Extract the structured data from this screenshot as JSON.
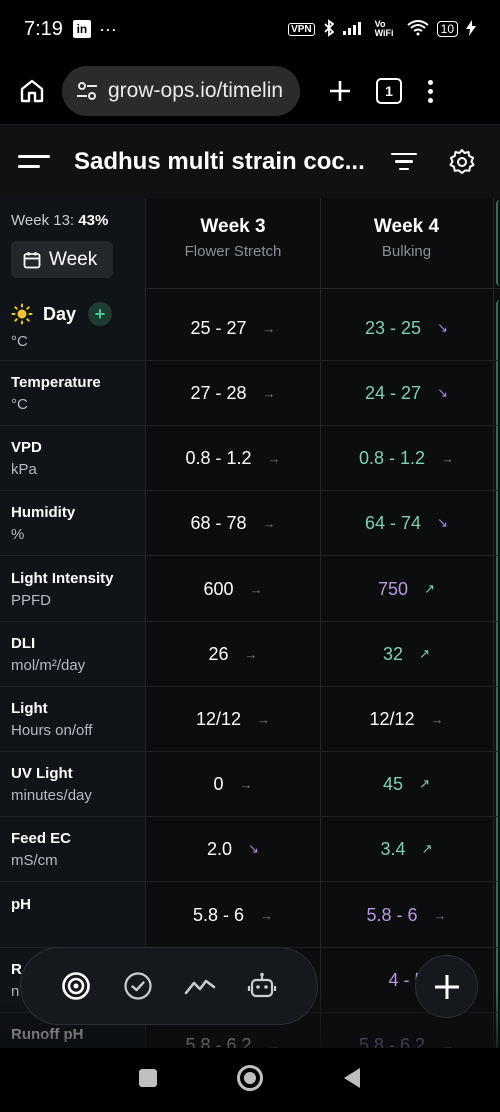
{
  "status_bar": {
    "time": "7:19",
    "left_icons": [
      "linkedin-icon",
      "more-dots-icon"
    ],
    "vpn": "VPN",
    "battery": "10",
    "network": "Vo WiFi"
  },
  "browser": {
    "url": "grow-ops.io/timelin",
    "tab_count": "1"
  },
  "app": {
    "title": "Sadhus multi strain coc..."
  },
  "timeline": {
    "week_progress_label": "Week 13:",
    "week_progress_value": "43%",
    "week_button": "Week",
    "day_toggle": "Day",
    "day_add": "+",
    "weeks": [
      {
        "name": "Week 3",
        "phase": "Flower Stretch"
      },
      {
        "name": "Week 4",
        "phase": "Bulking"
      }
    ],
    "partial_top_row": {
      "unit": "°C",
      "values": [
        {
          "text": "25 - 27",
          "arrow": "→",
          "color": "#ffffff",
          "arrow_color": "#747a82"
        },
        {
          "text": "23 - 25",
          "arrow": "↘",
          "color": "#7fd0b2",
          "arrow_color": "#a58ae0"
        }
      ]
    },
    "rows": [
      {
        "label": "Temperature",
        "unit": "°C",
        "values": [
          {
            "text": "27 - 28",
            "arrow": "→",
            "color": "#ffffff",
            "arrow_color": "#747a82"
          },
          {
            "text": "24 - 27",
            "arrow": "↘",
            "color": "#7fd0b2",
            "arrow_color": "#a58ae0"
          }
        ]
      },
      {
        "label": "VPD",
        "unit": "kPa",
        "values": [
          {
            "text": "0.8 - 1.2",
            "arrow": "→",
            "color": "#ffffff",
            "arrow_color": "#747a82"
          },
          {
            "text": "0.8 - 1.2",
            "arrow": "→",
            "color": "#7fd0b2",
            "arrow_color": "#747a82"
          }
        ]
      },
      {
        "label": "Humidity",
        "unit": "%",
        "values": [
          {
            "text": "68 - 78",
            "arrow": "→",
            "color": "#ffffff",
            "arrow_color": "#747a82"
          },
          {
            "text": "64 - 74",
            "arrow": "↘",
            "color": "#7fd0b2",
            "arrow_color": "#a58ae0"
          }
        ]
      },
      {
        "label": "Light Intensity",
        "unit": "PPFD",
        "values": [
          {
            "text": "600",
            "arrow": "→",
            "color": "#ffffff",
            "arrow_color": "#747a82"
          },
          {
            "text": "750",
            "arrow": "↗",
            "color": "#b79ae0",
            "arrow_color": "#7fd0b2"
          }
        ]
      },
      {
        "label": "DLI",
        "unit": "mol/m²/day",
        "values": [
          {
            "text": "26",
            "arrow": "→",
            "color": "#ffffff",
            "arrow_color": "#747a82"
          },
          {
            "text": "32",
            "arrow": "↗",
            "color": "#7fd0b2",
            "arrow_color": "#7fd0b2"
          }
        ]
      },
      {
        "label": "Light",
        "unit": "Hours on/off",
        "values": [
          {
            "text": "12/12",
            "arrow": "→",
            "color": "#ffffff",
            "arrow_color": "#747a82"
          },
          {
            "text": "12/12",
            "arrow": "→",
            "color": "#ffffff",
            "arrow_color": "#747a82"
          }
        ]
      },
      {
        "label": "UV Light",
        "unit": "minutes/day",
        "values": [
          {
            "text": "0",
            "arrow": "→",
            "color": "#ffffff",
            "arrow_color": "#747a82"
          },
          {
            "text": "45",
            "arrow": "↗",
            "color": "#7fd0b2",
            "arrow_color": "#7fd0b2"
          }
        ]
      },
      {
        "label": "Feed EC",
        "unit": "mS/cm",
        "values": [
          {
            "text": "2.0",
            "arrow": "↘",
            "color": "#ffffff",
            "arrow_color": "#a58ae0"
          },
          {
            "text": "3.4",
            "arrow": "↗",
            "color": "#7fd0b2",
            "arrow_color": "#7fd0b2"
          }
        ]
      },
      {
        "label": "pH",
        "unit": "",
        "values": [
          {
            "text": "5.8 - 6",
            "arrow": "→",
            "color": "#ffffff",
            "arrow_color": "#747a82"
          },
          {
            "text": "5.8 - 6",
            "arrow": "→",
            "color": "#b79ae0",
            "arrow_color": "#747a82"
          }
        ]
      },
      {
        "label": "R",
        "unit": "n",
        "values": [
          {
            "text": "",
            "arrow": "",
            "color": "#ffffff",
            "arrow_color": "#747a82"
          },
          {
            "text": "4 - 5",
            "arrow": "",
            "color": "#b79ae0",
            "arrow_color": "#747a82"
          }
        ]
      },
      {
        "label": "Runoff pH",
        "unit": "",
        "values": [
          {
            "text": "5.8 - 6.2",
            "arrow": "→",
            "color": "#ffffff",
            "arrow_color": "#747a82"
          },
          {
            "text": "5.8 - 6.2",
            "arrow": "→",
            "color": "#b79ae0",
            "arrow_color": "#747a82"
          }
        ]
      }
    ]
  },
  "bottom_nav": {
    "items": [
      "target-icon",
      "check-circle-icon",
      "chart-line-icon",
      "robot-icon"
    ],
    "fab": "plus-icon"
  }
}
